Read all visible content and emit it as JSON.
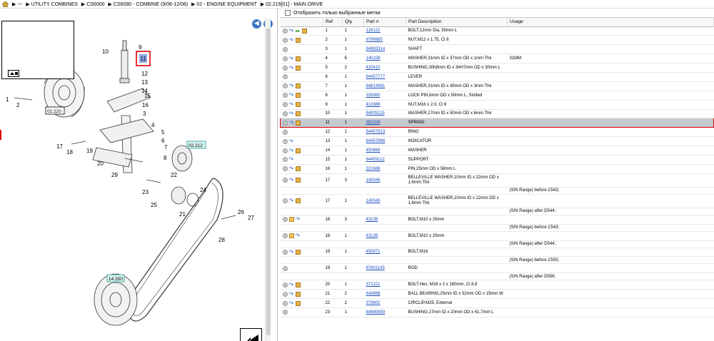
{
  "breadcrumb": [
    "---",
    "UTILITY COMBINES",
    "CS6000",
    "CS6090 - COMBINE (9/06-12/08)",
    "02 - ENGINE EQUIPMENT",
    "02.219[01] - MAIN DRIVE"
  ],
  "toolbar": {
    "show_selected_label": "Отобразить только выбранные метки"
  },
  "table": {
    "headers": {
      "ref": "Ref",
      "qty": "Qty",
      "part": "Part #",
      "desc": "Part Description",
      "usage": "Usage"
    },
    "rows": [
      {
        "type": "part",
        "ref": "1",
        "qty": "1",
        "part": "128122",
        "desc": "BOLT,12mm Dia, 50mm L",
        "usage": "",
        "icons": [
          "dot",
          "eye",
          "arrow",
          "box"
        ]
      },
      {
        "type": "part",
        "ref": "2",
        "qty": "1",
        "part": "9796885",
        "desc": "NUT,M12 x 1.75, Cl 8",
        "usage": "",
        "icons": [
          "dot",
          "eye",
          "box"
        ]
      },
      {
        "type": "part",
        "ref": "3",
        "qty": "1",
        "part": "84983314",
        "desc": "SHAFT",
        "usage": "",
        "icons": [
          "dot"
        ]
      },
      {
        "type": "part",
        "ref": "4",
        "qty": "6",
        "part": "140108",
        "desc": "WASHER,31mm ID x 37mm OD x 1mm Thk",
        "usage": "31MM",
        "icons": [
          "dot",
          "eye",
          "box"
        ]
      },
      {
        "type": "part",
        "ref": "5",
        "qty": "2",
        "part": "420410",
        "desc": "BUSHING,30h8mm ID x 34H7mm OD x 30mm L",
        "usage": "",
        "icons": [
          "dot",
          "eye",
          "box"
        ]
      },
      {
        "type": "part",
        "ref": "6",
        "qty": "1",
        "part": "84457777",
        "desc": "LEVER",
        "usage": "",
        "icons": [
          "dot"
        ]
      },
      {
        "type": "part",
        "ref": "7",
        "qty": "1",
        "part": "84814981",
        "desc": "WASHER,31mm ID x 45mm OD x 3mm Thk",
        "usage": "",
        "icons": [
          "dot",
          "eye",
          "box"
        ]
      },
      {
        "type": "part",
        "ref": "8",
        "qty": "1",
        "part": "333960",
        "desc": "LOCK PIN,6mm OD x 50mm L, Slotted",
        "usage": "",
        "icons": [
          "dot",
          "eye",
          "box"
        ]
      },
      {
        "type": "part",
        "ref": "9",
        "qty": "1",
        "part": "412866",
        "desc": "NUT,M16 x 2.0, Cl 8",
        "usage": "",
        "icons": [
          "dot",
          "eye",
          "box"
        ]
      },
      {
        "type": "part",
        "ref": "10",
        "qty": "1",
        "part": "84005115",
        "desc": "WASHER,17mm ID x 50mm OD x 6mm Thk",
        "usage": "",
        "icons": [
          "dot",
          "eye",
          "box"
        ]
      },
      {
        "type": "part",
        "ref": "11",
        "qty": "1",
        "part": "392328",
        "desc": "SPRING",
        "usage": "",
        "icons": [
          "dot",
          "eye",
          "box"
        ],
        "selected": true
      },
      {
        "type": "part",
        "ref": "12",
        "qty": "1",
        "part": "84457813",
        "desc": "RING",
        "usage": "",
        "icons": [
          "dot"
        ]
      },
      {
        "type": "part",
        "ref": "13",
        "qty": "1",
        "part": "84457866",
        "desc": "INDICATOR",
        "usage": "",
        "icons": [
          "dot",
          "eye"
        ]
      },
      {
        "type": "part",
        "ref": "14",
        "qty": "1",
        "part": "450869",
        "desc": "WASHER",
        "usage": "",
        "icons": [
          "dot",
          "eye",
          "box"
        ]
      },
      {
        "type": "part",
        "ref": "15",
        "qty": "1",
        "part": "84459112",
        "desc": "SUPPORT",
        "usage": "",
        "icons": [
          "dot",
          "eye"
        ]
      },
      {
        "type": "part",
        "ref": "16",
        "qty": "1",
        "part": "321686",
        "desc": "PIN,25mm OD x 58mm L",
        "usage": "",
        "icons": [
          "dot",
          "eye",
          "box"
        ]
      },
      {
        "type": "tall",
        "ref": "17",
        "qty": "3",
        "part": "140045",
        "desc": "BELLEVILLE WASHER,10mm ID x 22mm OD x 1.6mm Thk",
        "usage": "",
        "icons": [
          "dot",
          "eye",
          "box"
        ]
      },
      {
        "type": "note",
        "note": "(S/N Range) before C543;"
      },
      {
        "type": "tall",
        "ref": "17",
        "qty": "1",
        "part": "140045",
        "desc": "BELLEVILLE WASHER,10mm ID x 22mm OD x 1.6mm Thk",
        "usage": "",
        "icons": [
          "dot",
          "eye",
          "box"
        ]
      },
      {
        "type": "note",
        "note": "(S/N Range) after D544;"
      },
      {
        "type": "part",
        "ref": "18",
        "qty": "3",
        "part": "43139",
        "desc": "BOLT,M10 x 25mm",
        "usage": "",
        "icons": [
          "dot",
          "note",
          "eye"
        ]
      },
      {
        "type": "note",
        "note": "(S/N Range) before C543;"
      },
      {
        "type": "part",
        "ref": "18",
        "qty": "1",
        "part": "43139",
        "desc": "BOLT,M10 x 25mm",
        "usage": "",
        "icons": [
          "dot",
          "note",
          "eye"
        ]
      },
      {
        "type": "note",
        "note": "(S/N Range) after D544;"
      },
      {
        "type": "part",
        "ref": "19",
        "qty": "1",
        "part": "450871",
        "desc": "BOLT,M16",
        "usage": "",
        "icons": [
          "dot",
          "eye",
          "box"
        ]
      },
      {
        "type": "note",
        "note": "(S/N Range) before C555;"
      },
      {
        "type": "part",
        "ref": "19",
        "qty": "1",
        "part": "87601143",
        "desc": "ROD",
        "usage": "",
        "icons": [
          "dot"
        ]
      },
      {
        "type": "note",
        "note": "(S/N Range) after D556;"
      },
      {
        "type": "part",
        "ref": "20",
        "qty": "1",
        "part": "371221",
        "desc": "BOLT,Hex, M16 x 2 x 160mm, Cl 8.8",
        "usage": "",
        "icons": [
          "dot",
          "eye",
          "box"
        ]
      },
      {
        "type": "part",
        "ref": "21",
        "qty": "2",
        "part": "443898",
        "desc": "BALL BEARING,25mm ID x 52mm OD x 15mm W",
        "usage": "",
        "icons": [
          "dot",
          "eye",
          "box"
        ]
      },
      {
        "type": "part",
        "ref": "22",
        "qty": "2",
        "part": "379802",
        "desc": "CIRCLIP,M25, External",
        "usage": "",
        "icons": [
          "dot",
          "eye",
          "box"
        ]
      },
      {
        "type": "part",
        "ref": "23",
        "qty": "1",
        "part": "84980659",
        "desc": "BUSHING,17mm ID x 20mm OD x 61.7mm L",
        "usage": "",
        "icons": [
          "dot"
        ]
      }
    ]
  },
  "diagram": {
    "callouts": [
      "1",
      "2",
      "3",
      "4",
      "5",
      "6",
      "7",
      "8",
      "9",
      "10",
      "11",
      "12",
      "13",
      "14",
      "15",
      "16",
      "17",
      "18",
      "19",
      "20",
      "21",
      "22",
      "23",
      "24",
      "25",
      "26",
      "27",
      "28",
      "29"
    ],
    "ref_boxes": [
      "02.220",
      "02.212",
      "14.350"
    ],
    "selected_callout": "11"
  }
}
